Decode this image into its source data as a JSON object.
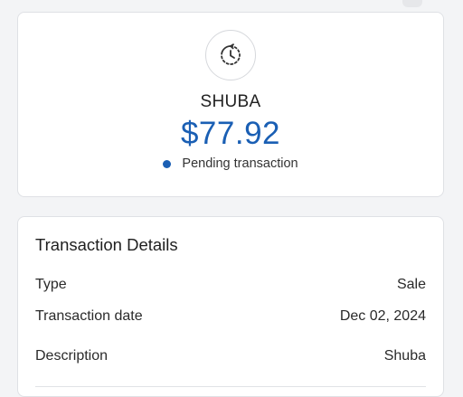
{
  "summary": {
    "merchant": "SHUBA",
    "amount": "$77.92",
    "status": "Pending transaction",
    "icon": "pending-clock-icon",
    "accent_color": "#1a5fb4"
  },
  "details": {
    "title": "Transaction Details",
    "rows": [
      {
        "label": "Type",
        "value": "Sale"
      },
      {
        "label": "Transaction date",
        "value": "Dec 02, 2024"
      },
      {
        "label": "Description",
        "value": "Shuba"
      }
    ]
  }
}
